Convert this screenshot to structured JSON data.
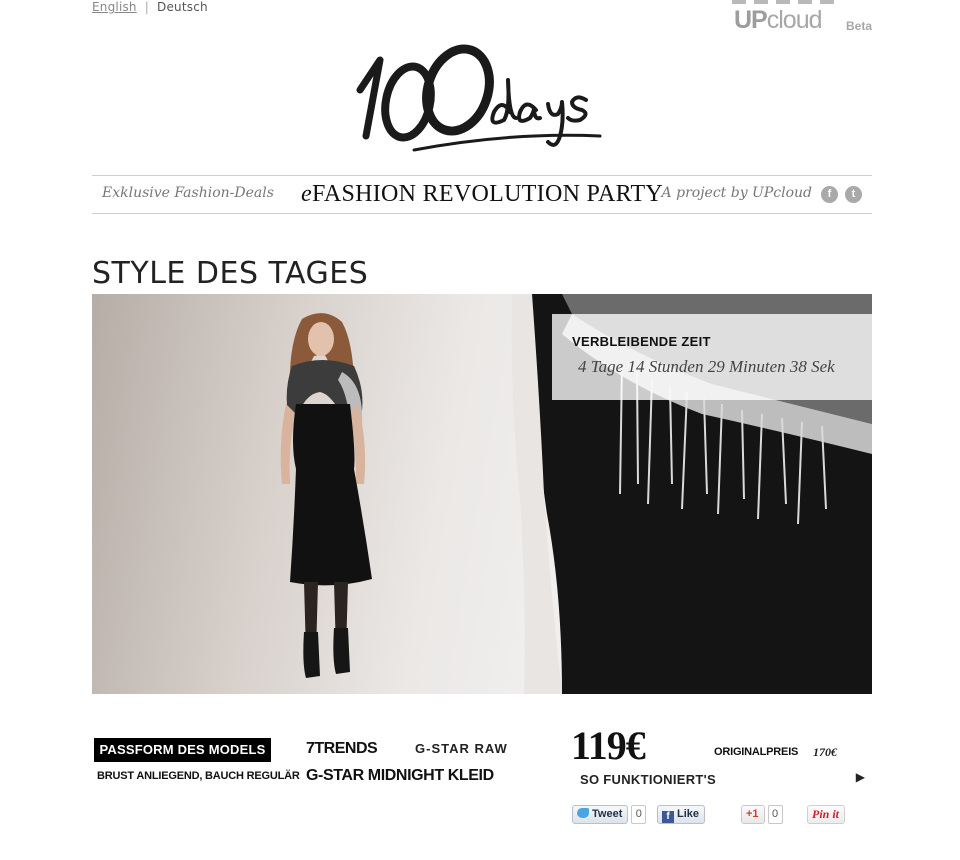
{
  "lang": {
    "english": "English",
    "separator": "|",
    "deutsch": "Deutsch"
  },
  "upcloud_logo": {
    "up": "UP",
    "cloud": "cloud",
    "beta": "Beta"
  },
  "logo": {
    "number": "100",
    "word": "days"
  },
  "nav": {
    "left": "Exklusive Fashion-Deals",
    "center_prefix": "e",
    "center_rest": "FASHION REVOLUTION PARTY",
    "right": "A project by UPcloud",
    "facebook_glyph": "f",
    "twitter_glyph": "t"
  },
  "headline": "STYLE DES TAGES",
  "timer": {
    "label": "VERBLEIBENDE ZEIT",
    "value": "4  Tage 14 Stunden 29 Minuten 38 Sek"
  },
  "fit": {
    "button": "PASSFORM DES MODELS",
    "description": "BRUST ANLIEGEND, BAUCH REGULÄR"
  },
  "brands": {
    "first": "7TRENDS",
    "second": "G-STAR RAW"
  },
  "product_name": "G-STAR MIDNIGHT KLEID",
  "price": {
    "current": "119€",
    "original_label": "ORIGINALPREIS",
    "original_value": "170€"
  },
  "how_it_works": {
    "label": "SO FUNKTIONIERT'S",
    "arrow": "▶"
  },
  "share": {
    "tweet": "Tweet",
    "tweet_count": "0",
    "like": "Like",
    "gplus": "+1",
    "gplus_count": "0",
    "pin": "Pin it"
  },
  "colors": {
    "accent": "#000000",
    "muted": "#777777",
    "divider": "#cfcfcf"
  }
}
